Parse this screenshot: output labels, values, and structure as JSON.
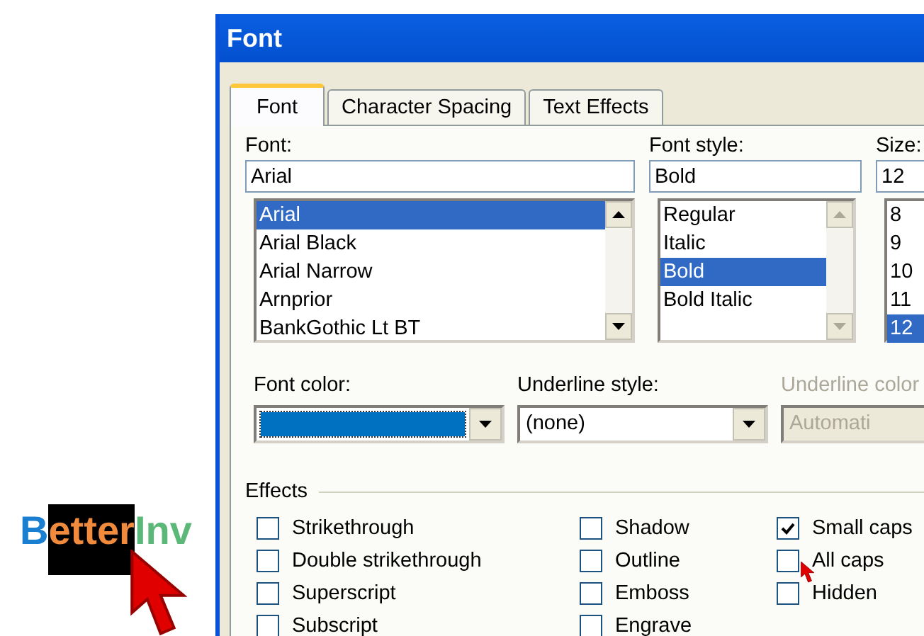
{
  "logo": {
    "parts": [
      {
        "text": "B",
        "color": "#1a7fd0",
        "highlighted": false
      },
      {
        "text": "etter",
        "color": "#f08a3c",
        "highlighted": true
      },
      {
        "text": "Inv",
        "color": "#5cb878",
        "highlighted": false
      }
    ]
  },
  "window": {
    "title": "Font"
  },
  "tabs": [
    {
      "label": "Font",
      "selected": true
    },
    {
      "label": "Character Spacing",
      "selected": false
    },
    {
      "label": "Text Effects",
      "selected": false
    }
  ],
  "font": {
    "label": "Font:",
    "value": "Arial",
    "items": [
      {
        "label": "Arial",
        "selected": true
      },
      {
        "label": "Arial Black",
        "selected": false
      },
      {
        "label": "Arial Narrow",
        "selected": false
      },
      {
        "label": "Arnprior",
        "selected": false
      },
      {
        "label": "BankGothic Lt BT",
        "selected": false
      }
    ]
  },
  "font_style": {
    "label": "Font style:",
    "value": "Bold",
    "items": [
      {
        "label": "Regular",
        "selected": false
      },
      {
        "label": "Italic",
        "selected": false
      },
      {
        "label": "Bold",
        "selected": true
      },
      {
        "label": "Bold Italic",
        "selected": false
      }
    ]
  },
  "size": {
    "label": "Size:",
    "value": "12",
    "items": [
      {
        "label": "8",
        "selected": false
      },
      {
        "label": "9",
        "selected": false
      },
      {
        "label": "10",
        "selected": false
      },
      {
        "label": "11",
        "selected": false
      },
      {
        "label": "12",
        "selected": true
      }
    ]
  },
  "dropdowns": [
    {
      "label": "Font color:",
      "kind": "swatch",
      "color": "#0070c0",
      "disabled": false
    },
    {
      "label": "Underline style:",
      "kind": "text",
      "value": "(none)",
      "disabled": false
    },
    {
      "label": "Underline color",
      "kind": "text",
      "value": "Automati",
      "disabled": true
    }
  ],
  "effects": {
    "title": "Effects",
    "columns": [
      [
        {
          "label": "Strikethrough",
          "checked": false
        },
        {
          "label": "Double strikethrough",
          "checked": false
        },
        {
          "label": "Superscript",
          "checked": false
        },
        {
          "label": "Subscript",
          "checked": false
        }
      ],
      [
        {
          "label": "Shadow",
          "checked": false
        },
        {
          "label": "Outline",
          "checked": false
        },
        {
          "label": "Emboss",
          "checked": false
        },
        {
          "label": "Engrave",
          "checked": false
        }
      ],
      [
        {
          "label": "Small caps",
          "checked": true
        },
        {
          "label": "All caps",
          "checked": false
        },
        {
          "label": "Hidden",
          "checked": false
        }
      ]
    ]
  }
}
